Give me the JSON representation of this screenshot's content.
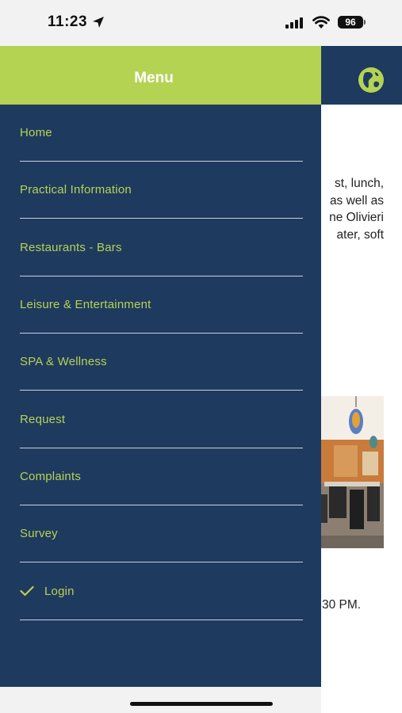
{
  "status_bar": {
    "time": "11:23",
    "battery": "96"
  },
  "drawer": {
    "title": "Menu",
    "items": [
      {
        "label": "Home"
      },
      {
        "label": "Practical Information"
      },
      {
        "label": "Restaurants - Bars"
      },
      {
        "label": "Leisure & Entertainment"
      },
      {
        "label": "SPA & Wellness"
      },
      {
        "label": "Request"
      },
      {
        "label": "Complaints"
      },
      {
        "label": "Survey"
      },
      {
        "label": "Login",
        "checked": true
      }
    ]
  },
  "background_page": {
    "text_lines": [
      "st,  lunch,",
      "as well as",
      "ne Olivieri",
      "ater,  soft"
    ],
    "hours_text": "30 PM."
  },
  "colors": {
    "navy": "#1f3a5f",
    "lime": "#b5d353"
  }
}
